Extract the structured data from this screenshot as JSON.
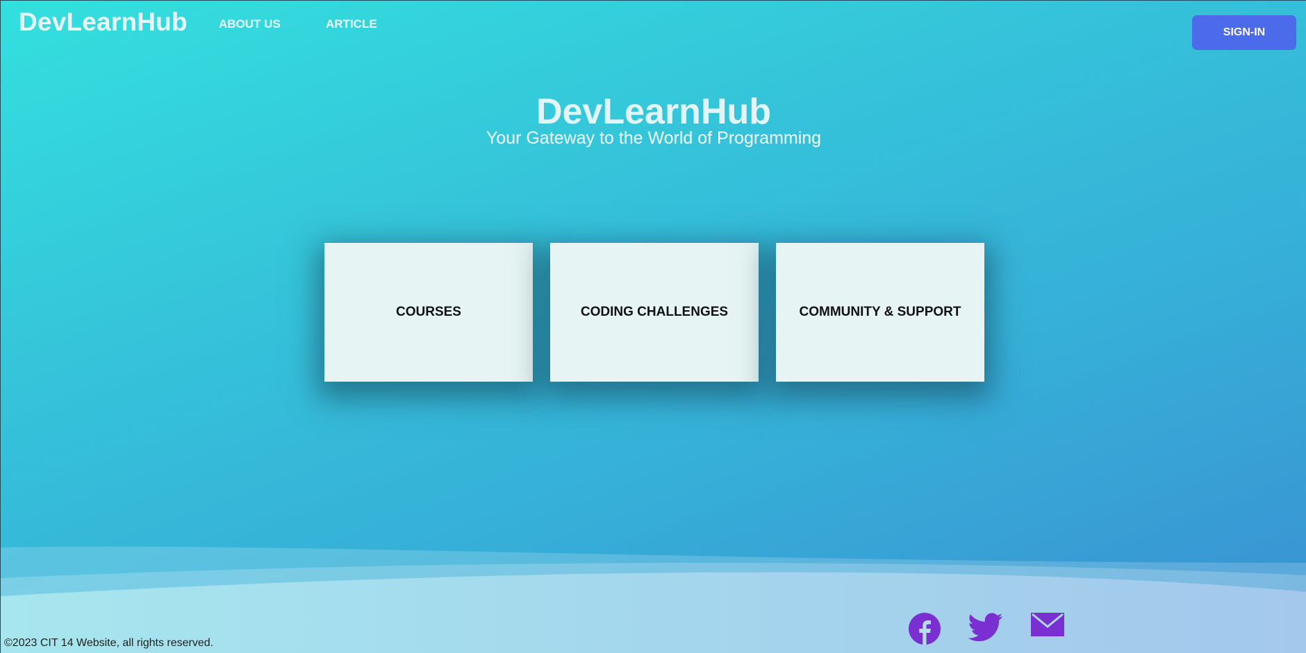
{
  "header": {
    "brand": "DevLearnHub",
    "nav": [
      {
        "label": "ABOUT US"
      },
      {
        "label": "ARTICLE"
      }
    ],
    "signin_label": "SIGN-IN"
  },
  "hero": {
    "title": "DevLearnHub",
    "subtitle": "Your Gateway to the World of Programming"
  },
  "cards": [
    {
      "label": "COURSES"
    },
    {
      "label": "CODING CHALLENGES"
    },
    {
      "label": "COMMUNITY & SUPPORT"
    }
  ],
  "footer": {
    "copyright": "©2023 CIT 14 Website, all rights reserved.",
    "social_icons": [
      "facebook-icon",
      "twitter-icon",
      "email-icon"
    ]
  },
  "colors": {
    "gradient_start": "#33e0de",
    "gradient_end": "#3a8fd1",
    "signin_button": "#4c6bea",
    "card_background": "#e6f4f3",
    "social_icon": "#7a2fd0"
  }
}
